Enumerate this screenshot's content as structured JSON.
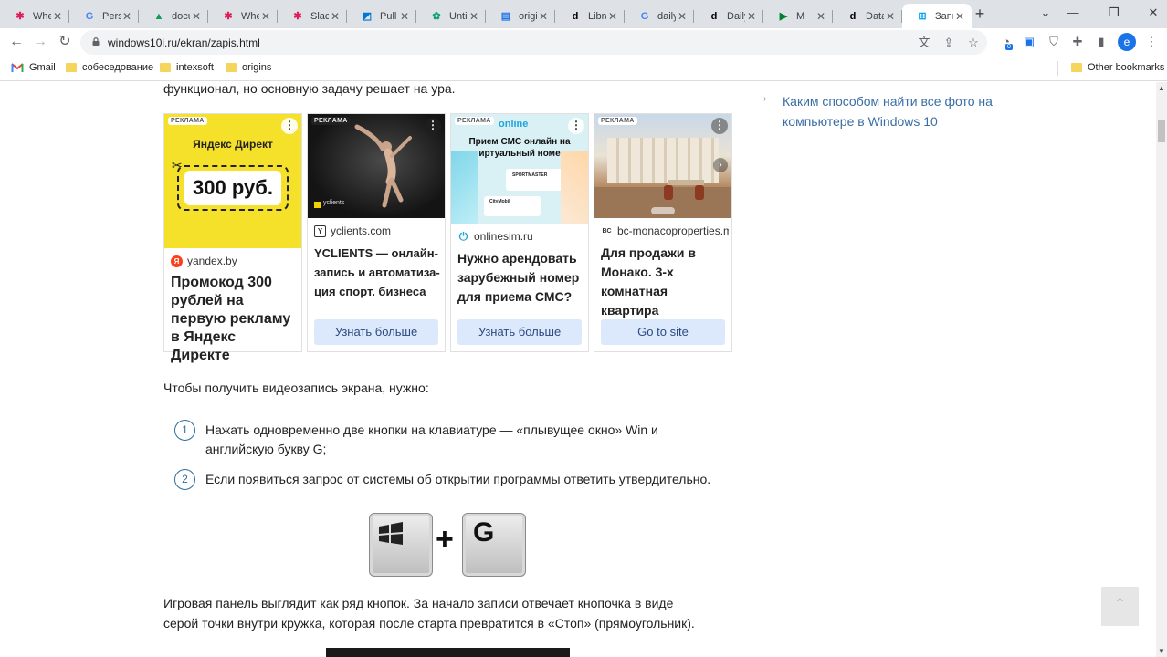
{
  "tabs": [
    {
      "label": "Whe",
      "icon": "slack-icon",
      "color": "#e01e5a"
    },
    {
      "label": "Pers",
      "icon": "google-icon",
      "color": "#4285f4"
    },
    {
      "label": "docu",
      "icon": "drive-icon",
      "color": "#0f9d58"
    },
    {
      "label": "Whe",
      "icon": "slack-icon",
      "color": "#e01e5a"
    },
    {
      "label": "Slack",
      "icon": "slack-icon",
      "color": "#e01e5a"
    },
    {
      "label": "Pull",
      "icon": "azure-devops-icon",
      "color": "#0078d4"
    },
    {
      "label": "Unti",
      "icon": "chatgpt-icon",
      "color": "#10a37f"
    },
    {
      "label": "origi",
      "icon": "document-icon",
      "color": "#1a73e8"
    },
    {
      "label": "Libra",
      "icon": "d-icon",
      "color": "#000000"
    },
    {
      "label": "daily",
      "icon": "google-icon",
      "color": "#4285f4"
    },
    {
      "label": "Daily",
      "icon": "d-icon",
      "color": "#000000"
    },
    {
      "label": "M",
      "icon": "meet-icon",
      "color": "#00832d"
    },
    {
      "label": "Data",
      "icon": "d-icon",
      "color": "#000000"
    },
    {
      "label": "Запи",
      "icon": "windows-icon",
      "color": "#00a4ef",
      "active": true
    }
  ],
  "address": {
    "url": "windows10i.ru/ekran/zapis.html"
  },
  "profile_initial": "e",
  "extension_badge": "0",
  "bookmarks": [
    {
      "label": "Gmail",
      "icon": "gmail-icon"
    },
    {
      "label": "собеседование",
      "icon": "folder-icon"
    },
    {
      "label": "intexsoft",
      "icon": "folder-icon"
    },
    {
      "label": "origins",
      "icon": "folder-icon"
    }
  ],
  "other_bookmarks": "Other bookmarks",
  "article": {
    "intro_tail": "функционал, но основную задачу решает на ура.",
    "video_intro": "Чтобы получить видеозапись экрана, нужно:",
    "steps": [
      {
        "num": "1",
        "text": "Нажать одновременно две кнопки на клавиатуре — «плывущее окно» Win и английскую букву G;"
      },
      {
        "num": "2",
        "text": "Если появиться запрос от системы об открытии программы ответить утвердительно."
      }
    ],
    "key_g": "G",
    "plus": "+",
    "gamebar_text": "Игровая панель выглядит как ряд кнопок. За начало записи отвечает кнопочка в виде серой точки внутри кружка, которая после старта превратится в «Стоп» (прямоугольник)."
  },
  "sidebar": {
    "link": "Каким способом найти все фото на компьютере в Windows 10"
  },
  "ads": [
    {
      "badge": "РЕКЛАМА",
      "img_brand": "Яндекс Директ",
      "img_price": "300 руб.",
      "domain": "yandex.by",
      "headline": "Промокод 300 рублей на первую рекламу в Яндекс Директе",
      "cta": ""
    },
    {
      "badge": "РЕКЛАМА",
      "img_caption": "yclients",
      "domain": "yclients.com",
      "headline": "YCLIENTS — онлайн-запись и автоматиза-ция спорт. бизнеса",
      "cta": "Узнать больше"
    },
    {
      "badge": "РЕКЛАМА",
      "img_logo": "online",
      "img_text": "Прием СМС онлайн на виртуальный номер",
      "img_brand1": "SPORTMASTER",
      "img_brand2": "CityMobil",
      "domain": "onlinesim.ru",
      "headline": "Нужно арендовать зарубежный номер для приема СМС?",
      "cta": "Узнать больше"
    },
    {
      "badge": "РЕКЛАМА",
      "domain": "bc-monacoproperties.m",
      "headline": "Для продажи в Монако. 3-х комнатная квартира",
      "cta": "Go to site"
    }
  ],
  "colors": {
    "link": "#3a6ea5",
    "accent": "#2c6e9e",
    "cta_bg": "#dce8fb",
    "yandex_yellow": "#f5e02a"
  }
}
